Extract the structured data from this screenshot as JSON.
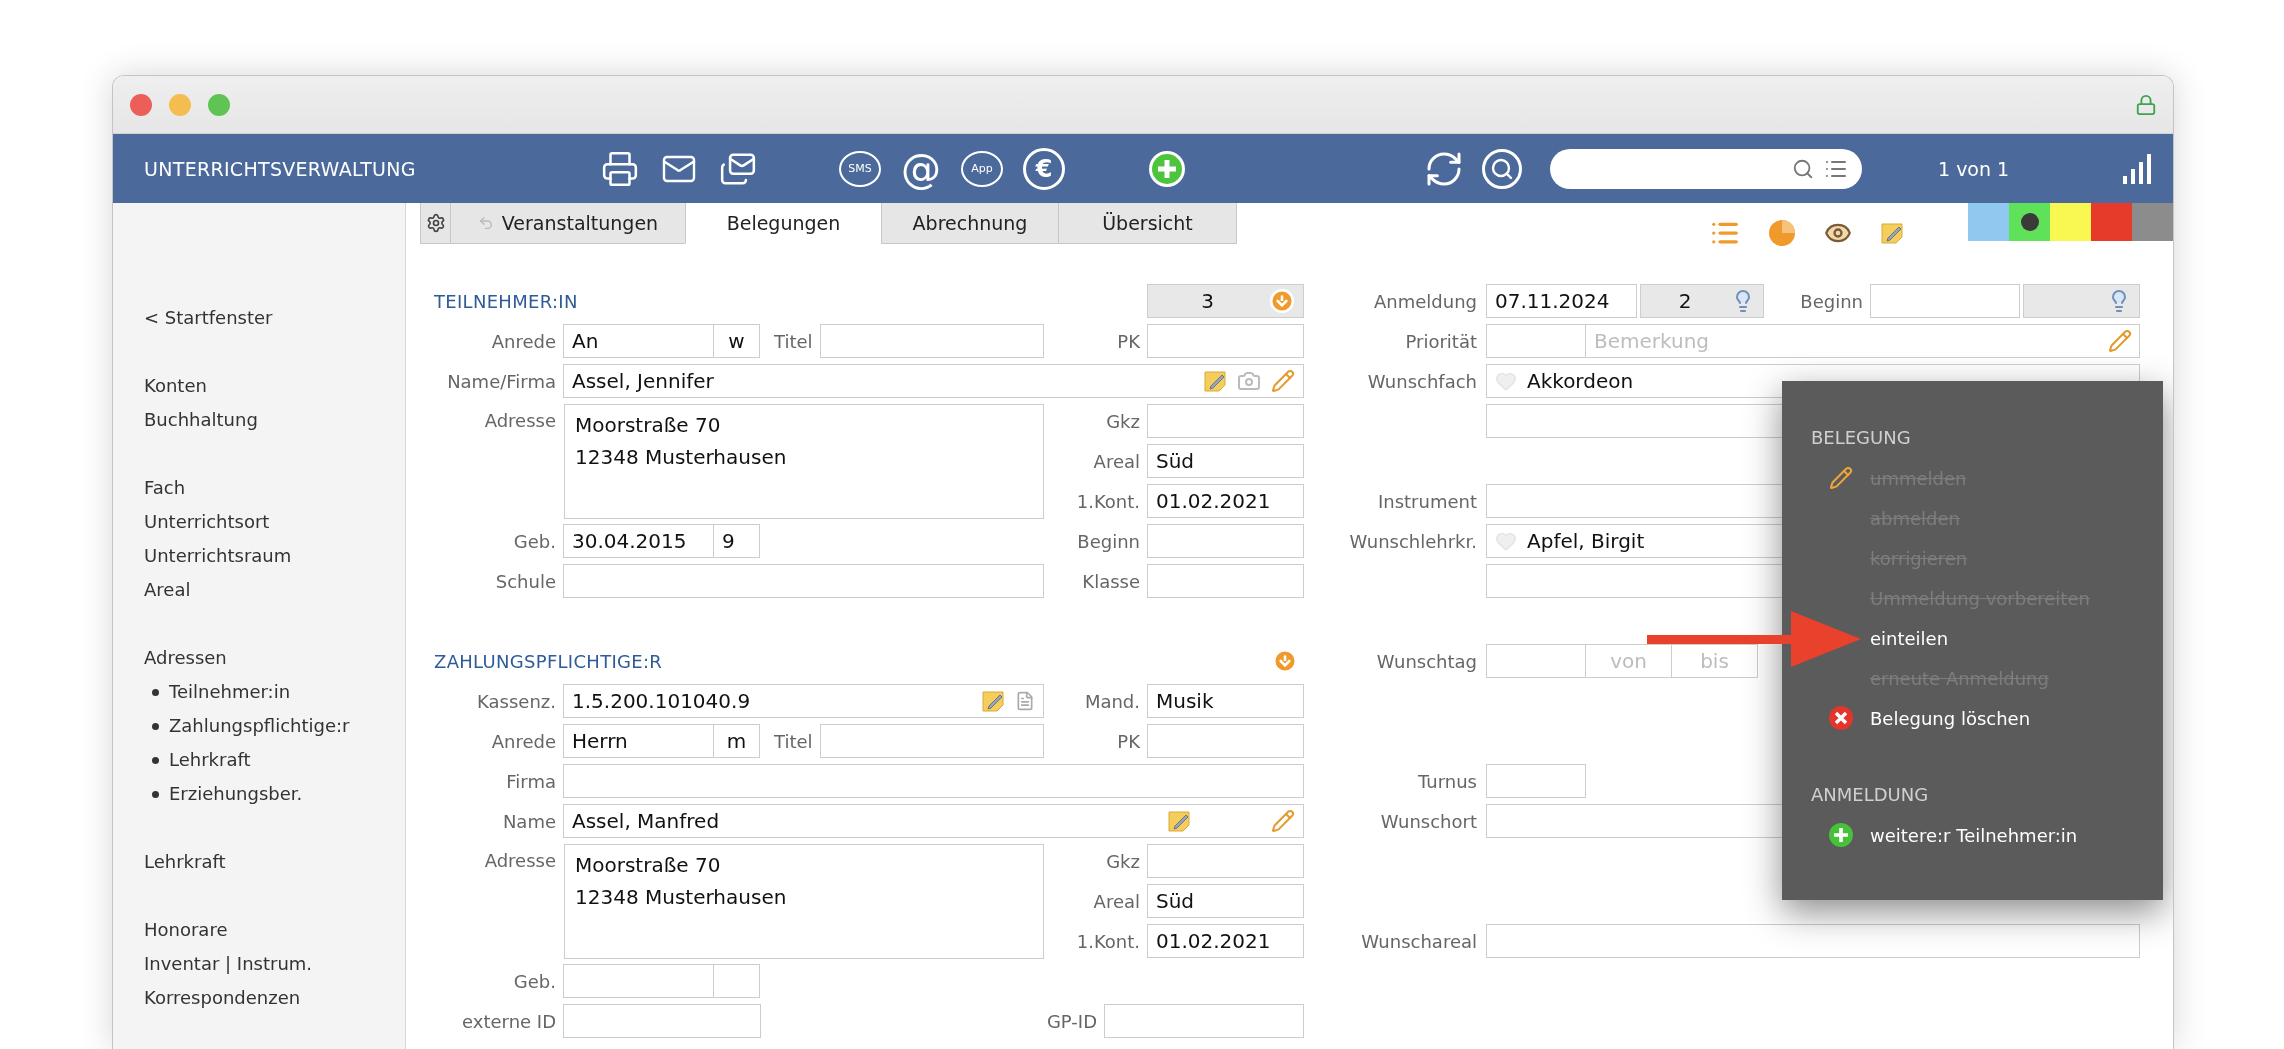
{
  "header": {
    "title": "UNTERRICHTSVERWALTUNG",
    "toolbar_groups": [
      [
        {
          "kind": "print"
        },
        {
          "kind": "mail"
        },
        {
          "kind": "mails"
        }
      ],
      [
        {
          "kind": "bubble",
          "text": "SMS"
        },
        {
          "kind": "symbol",
          "text": "@"
        },
        {
          "kind": "bubble",
          "text": "App"
        },
        {
          "kind": "circle",
          "text": "€"
        }
      ],
      [
        {
          "kind": "add"
        }
      ]
    ],
    "record_count": "1 von 1"
  },
  "tabs": [
    {
      "label": "Veranstaltungen",
      "selected": false
    },
    {
      "label": "Belegungen",
      "selected": true
    },
    {
      "label": "Abrechnung",
      "selected": false
    },
    {
      "label": "Übersicht",
      "selected": false
    }
  ],
  "color_filters": [
    {
      "color": "#8fc9ef",
      "selected": false
    },
    {
      "color": "#5fe25a",
      "selected": true
    },
    {
      "color": "#f9f852",
      "selected": false
    },
    {
      "color": "#e63a2b",
      "selected": false
    },
    {
      "color": "#8c8c8c",
      "selected": false
    }
  ],
  "sidebar": {
    "groups": [
      {
        "items": [
          {
            "label": "< Startfenster"
          }
        ]
      },
      {
        "items": [
          {
            "label": "Konten"
          },
          {
            "label": "Buchhaltung"
          }
        ]
      },
      {
        "items": [
          {
            "label": "Fach"
          },
          {
            "label": "Unterrichtsort"
          },
          {
            "label": "Unterrichtsraum"
          },
          {
            "label": "Areal"
          }
        ]
      },
      {
        "items": [
          {
            "label": "Adressen",
            "children": [
              {
                "label": "Teilnehmer:in"
              },
              {
                "label": "Zahlungspflichtige:r"
              },
              {
                "label": "Lehrkraft"
              },
              {
                "label": "Erziehungsber."
              }
            ]
          }
        ]
      },
      {
        "items": [
          {
            "label": "Lehrkraft"
          }
        ]
      },
      {
        "items": [
          {
            "label": "Honorare"
          },
          {
            "label": "Inventar | Instrum."
          },
          {
            "label": "Korrespondenzen"
          }
        ]
      }
    ]
  },
  "participant": {
    "heading": "TEILNEHMER:IN",
    "number": "3",
    "salutation": {
      "label": "Anrede",
      "value": "An",
      "gender": "w"
    },
    "title": {
      "label": "Titel"
    },
    "pk": {
      "label": "PK"
    },
    "name": {
      "label": "Name/Firma",
      "value": "Assel, Jennifer"
    },
    "address": {
      "label": "Adresse",
      "lines": [
        "Moorstraße 70",
        "12348 Musterhausen"
      ]
    },
    "gkz": {
      "label": "Gkz"
    },
    "area": {
      "label": "Areal",
      "value": "Süd"
    },
    "first_contact": {
      "label": "1.Kont.",
      "value": "01.02.2021"
    },
    "birth": {
      "label": "Geb.",
      "value": "30.04.2015",
      "age": "9"
    },
    "start": {
      "label": "Beginn"
    },
    "school": {
      "label": "Schule"
    },
    "class": {
      "label": "Klasse"
    }
  },
  "payer": {
    "heading": "ZAHLUNGSPFLICHTIGE:R",
    "cash_id": {
      "label": "Kassenz.",
      "value": "1.5.200.101040.9"
    },
    "mandant": {
      "label": "Mand.",
      "value": "Musik"
    },
    "salutation": {
      "label": "Anrede",
      "value": "Herrn",
      "gender": "m"
    },
    "title": {
      "label": "Titel"
    },
    "pk": {
      "label": "PK"
    },
    "company": {
      "label": "Firma"
    },
    "name": {
      "label": "Name",
      "value": "Assel, Manfred"
    },
    "address": {
      "label": "Adresse",
      "lines": [
        "Moorstraße 70",
        "12348 Musterhausen"
      ]
    },
    "gkz": {
      "label": "Gkz"
    },
    "area": {
      "label": "Areal",
      "value": "Süd"
    },
    "first_contact": {
      "label": "1.Kont.",
      "value": "01.02.2021"
    },
    "birth": {
      "label": "Geb."
    },
    "external_id": {
      "label": "externe ID"
    },
    "gp_id": {
      "label": "GP-ID"
    }
  },
  "registration": {
    "date": {
      "label": "Anmeldung",
      "value": "07.11.2024",
      "number": "2"
    },
    "start": {
      "label": "Beginn"
    },
    "priority": {
      "label": "Priorität",
      "placeholder": "Bemerkung"
    },
    "subject": {
      "label": "Wunschfach",
      "value": "Akkordeon"
    },
    "instrument": {
      "label": "Instrument"
    },
    "teacher": {
      "label": "Wunschlehrkr.",
      "value": "Apfel, Birgit"
    },
    "day": {
      "label": "Wunschtag",
      "from_placeholder": "von",
      "to_placeholder": "bis"
    },
    "rhythm": {
      "label": "Turnus"
    },
    "place": {
      "label": "Wunschort"
    },
    "area": {
      "label": "Wunschareal"
    }
  },
  "menu": {
    "sections": [
      {
        "heading": "BELEGUNG",
        "items": [
          {
            "label": "ummelden",
            "kind": "edit",
            "disabled": true
          },
          {
            "label": "abmelden",
            "kind": "plain",
            "disabled": true
          },
          {
            "label": "korrigieren",
            "kind": "plain",
            "disabled": true
          },
          {
            "label": "Ummeldung vorbereiten",
            "kind": "plain",
            "disabled": true
          },
          {
            "label": "einteilen",
            "kind": "plain",
            "disabled": false
          },
          {
            "label": "erneute Anmeldung",
            "kind": "plain",
            "disabled": true
          },
          {
            "label": "Belegung löschen",
            "kind": "delete",
            "disabled": false
          }
        ]
      },
      {
        "heading": "ANMELDUNG",
        "items": [
          {
            "label": "weitere:r Teilnehmer:in",
            "kind": "add",
            "disabled": false
          }
        ]
      }
    ]
  }
}
